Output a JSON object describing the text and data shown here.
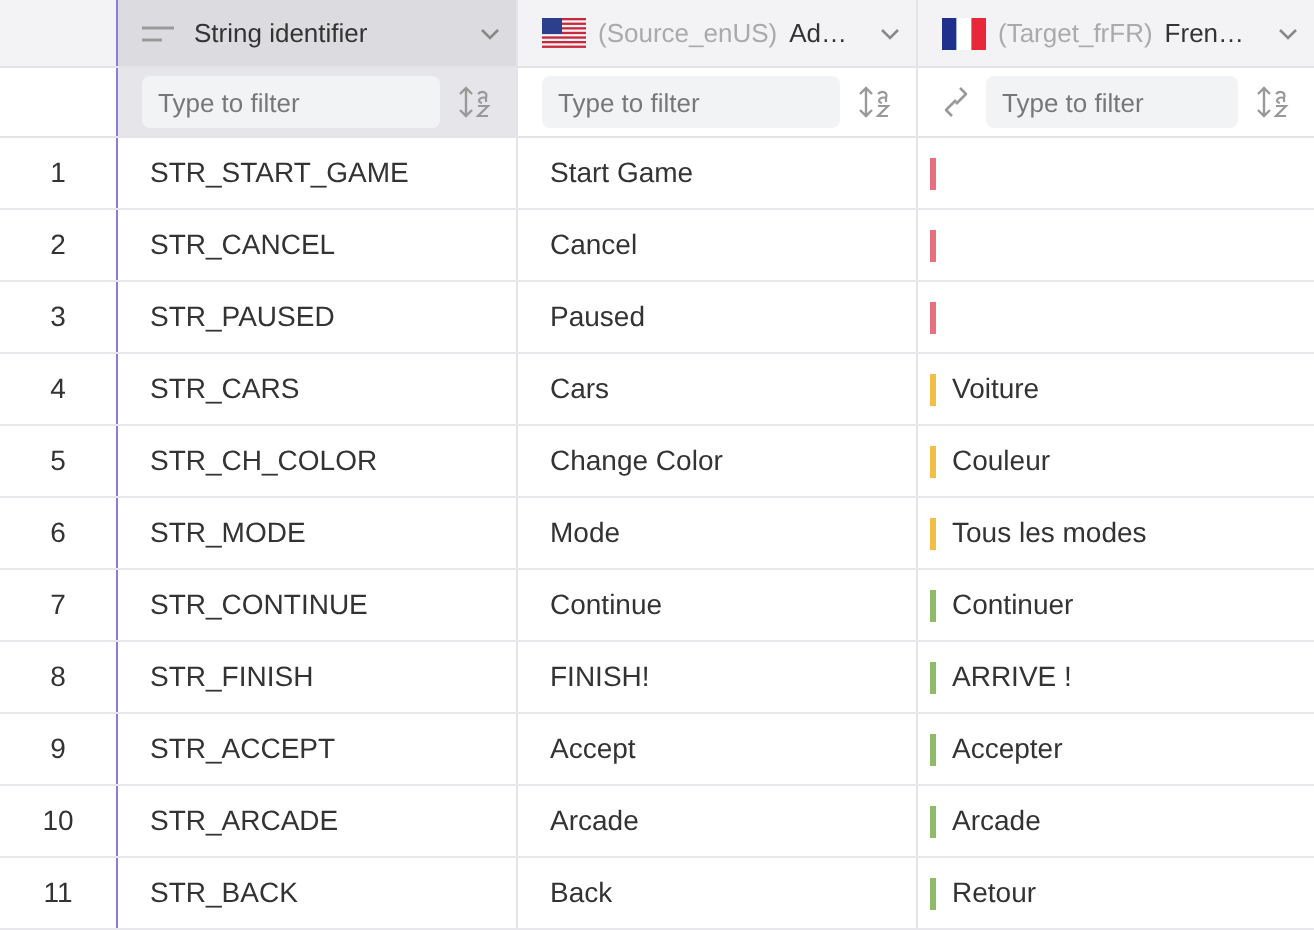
{
  "columns": [
    {
      "kind": "id",
      "selected": true,
      "title": "String identifier",
      "filter_placeholder": "Type to filter"
    },
    {
      "kind": "source",
      "selected": false,
      "source": "(Source_enUS)",
      "title": "Ad…",
      "filter_placeholder": "Type to filter"
    },
    {
      "kind": "target",
      "selected": false,
      "source": "(Target_frFR)",
      "title": "Fren…",
      "filter_placeholder": "Type to filter"
    }
  ],
  "rows": [
    {
      "number": "1",
      "id": "STR_START_GAME",
      "source": "Start Game",
      "target": "",
      "color": "#e8707e"
    },
    {
      "number": "2",
      "id": "STR_CANCEL",
      "source": "Cancel",
      "target": "",
      "color": "#e8707e"
    },
    {
      "number": "3",
      "id": "STR_PAUSED",
      "source": "Paused",
      "target": "",
      "color": "#e8707e"
    },
    {
      "number": "4",
      "id": "STR_CARS",
      "source": "Cars",
      "target": "Voiture",
      "color": "#f2bd48"
    },
    {
      "number": "5",
      "id": "STR_CH_COLOR",
      "source": "Change Color",
      "target": "Couleur",
      "color": "#f2bd48"
    },
    {
      "number": "6",
      "id": "STR_MODE",
      "source": "Mode",
      "target": "Tous les modes",
      "color": "#f2bd48"
    },
    {
      "number": "7",
      "id": "STR_CONTINUE",
      "source": "Continue",
      "target": "Continuer",
      "color": "#8fbc6a"
    },
    {
      "number": "8",
      "id": "STR_FINISH",
      "source": "FINISH!",
      "target": "ARRIVE !",
      "color": "#8fbc6a"
    },
    {
      "number": "9",
      "id": "STR_ACCEPT",
      "source": "Accept",
      "target": "Accepter",
      "color": "#8fbc6a"
    },
    {
      "number": "10",
      "id": "STR_ARCADE",
      "source": "Arcade",
      "target": "Arcade",
      "color": "#8fbc6a"
    },
    {
      "number": "11",
      "id": "STR_BACK",
      "source": "Back",
      "target": "Retour",
      "color": "#8fbc6a"
    }
  ]
}
